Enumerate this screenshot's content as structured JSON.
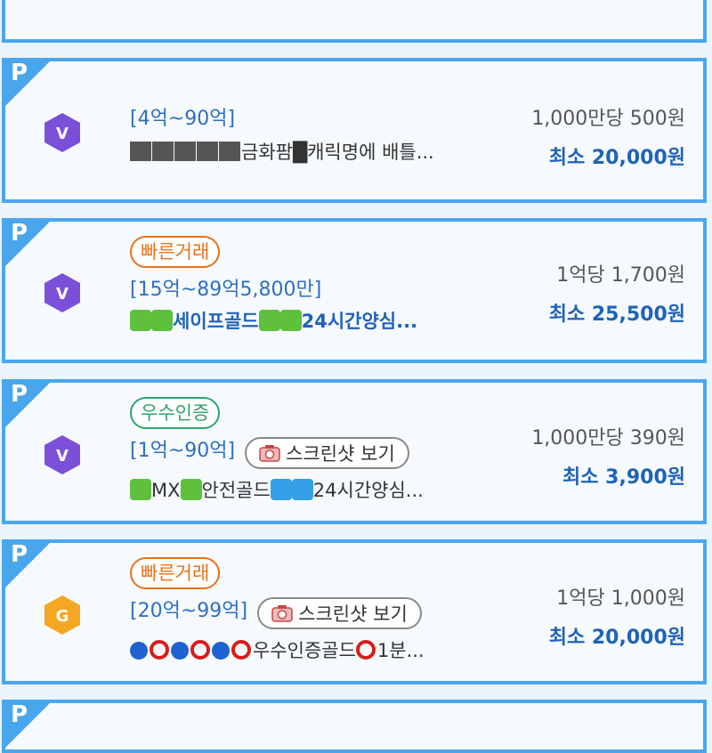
{
  "listings": [
    {
      "badge": "P",
      "tier_icon": "v-hex-icon",
      "tier_letter": "V",
      "tier_color": "#7b4fd8",
      "range": "[4억~90억]",
      "title": "금화팜█캐릭명에 배틀...",
      "rate": "1,000만당 500원",
      "minimum": "최소 20,000원"
    },
    {
      "badge": "P",
      "tier_icon": "v-hex-icon",
      "tier_letter": "V",
      "tier_color": "#7b4fd8",
      "tags": [
        "빠른거래"
      ],
      "range": "[15억~89억5,800만]",
      "title_a": "세이프골드",
      "title_b": "24시간양심...",
      "rate": "1억당 1,700원",
      "minimum": "최소 25,500원"
    },
    {
      "badge": "P",
      "tier_icon": "v-hex-icon",
      "tier_letter": "V",
      "tier_color": "#7b4fd8",
      "tags": [
        "우수인증"
      ],
      "range": "[1억~90억]",
      "screenshot_label": "스크린샷 보기",
      "title_a": "MX",
      "title_b": "안전골드",
      "title_c": "24시간양심...",
      "rate": "1,000만당 390원",
      "minimum": "최소 3,900원"
    },
    {
      "badge": "P",
      "tier_icon": "g-hex-icon",
      "tier_letter": "G",
      "tier_color": "#f5a623",
      "tags": [
        "빠른거래"
      ],
      "range": "[20억~99억]",
      "screenshot_label": "스크린샷 보기",
      "title_a": "우수인증골드",
      "title_b": "1분...",
      "rate": "1억당 1,000원",
      "minimum": "최소 20,000원"
    },
    {
      "badge": "P"
    }
  ]
}
